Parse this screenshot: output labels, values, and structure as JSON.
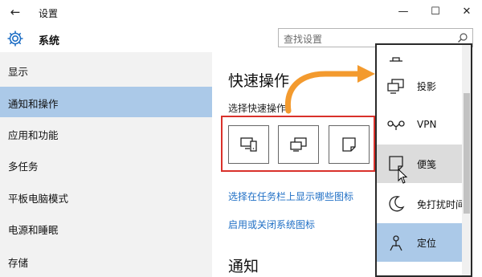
{
  "window": {
    "back_glyph": "←",
    "title": "设置",
    "minimize_glyph": "—",
    "maximize_glyph": "☐",
    "close_glyph": "✕"
  },
  "header": {
    "icon": "gear-icon",
    "app_name": "系统",
    "search_placeholder": "查找设置"
  },
  "sidebar": {
    "items": [
      {
        "label": "显示"
      },
      {
        "label": "通知和操作"
      },
      {
        "label": "应用和功能"
      },
      {
        "label": "多任务"
      },
      {
        "label": "平板电脑模式"
      },
      {
        "label": "电源和睡眠"
      },
      {
        "label": "存储"
      }
    ],
    "active_index": 1
  },
  "main": {
    "quick_actions_heading": "快速操作",
    "quick_actions_sub": "选择快速操作",
    "quick_actions": [
      {
        "icon": "tablet-mode-icon"
      },
      {
        "icon": "project-icon"
      },
      {
        "icon": "note-icon"
      }
    ],
    "links": [
      {
        "label": "选择在任务栏上显示哪些图标"
      },
      {
        "label": "启用或关闭系统图标"
      }
    ],
    "notifications_heading": "通知"
  },
  "dropdown": {
    "items": [
      {
        "icon": "project-icon",
        "label": "投影"
      },
      {
        "icon": "vpn-icon",
        "label": "VPN"
      },
      {
        "icon": "note-icon",
        "label": "便笺"
      },
      {
        "icon": "moon-icon",
        "label": "免打扰时间"
      },
      {
        "icon": "location-icon",
        "label": "定位"
      }
    ],
    "hover_index": 2,
    "selected_index": 4
  },
  "colors": {
    "sidebar_bg": "#f2f2f2",
    "selection": "#abc9e8",
    "link": "#1f6fc5",
    "highlight_box": "#d9312b",
    "arrow": "#f39a2e"
  }
}
